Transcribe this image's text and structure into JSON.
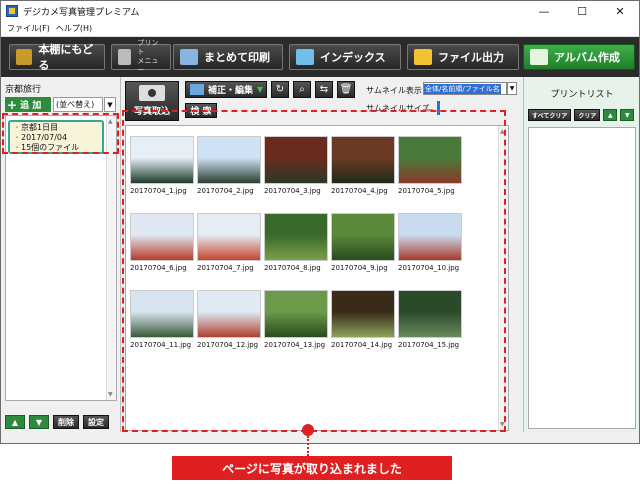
{
  "window": {
    "title": "デジカメ写真管理プレミアム",
    "controls": [
      "—",
      "☐",
      "✕"
    ]
  },
  "menu": [
    "ファイル(F)",
    "ヘルプ(H)"
  ],
  "toolbar": {
    "back_label": "本棚にもどる",
    "print_menu_line1": "プリント",
    "print_menu_line2": "メニュー",
    "batch_print_label": "まとめて印刷",
    "index_label": "インデックス",
    "export_label": "ファイル出力",
    "album_label": "アルバム作成"
  },
  "left_panel": {
    "title": "京都旅行",
    "add_label": "追 加",
    "sort_label": "(並べ替え)",
    "album_item": {
      "name": "京都1日目",
      "date": "2017/07/04",
      "count": "15個のファイル"
    },
    "delete_label": "削除",
    "settings_label": "設定"
  },
  "center": {
    "import_label": "写真取込",
    "edit_label": "補正・編集",
    "search_label": "検 索",
    "thumb_display_label": "サムネイル表示",
    "thumb_display_value": "全体/名前順/ファイル名",
    "thumb_size_label": "サムネイルサイズ"
  },
  "photos": [
    {
      "name": "20170704_1.jpg",
      "colors": [
        "#e6eef6",
        "#1f3a2a"
      ]
    },
    {
      "name": "20170704_2.jpg",
      "colors": [
        "#cfe2f4",
        "#2c3e2e"
      ]
    },
    {
      "name": "20170704_3.jpg",
      "colors": [
        "#6b2a1e",
        "#2a3a24"
      ]
    },
    {
      "name": "20170704_4.jpg",
      "colors": [
        "#6a3a24",
        "#1e2a1a"
      ]
    },
    {
      "name": "20170704_5.jpg",
      "colors": [
        "#4a7a3a",
        "#8a3a2a"
      ]
    },
    {
      "name": "20170704_6.jpg",
      "colors": [
        "#dfe8f2",
        "#b83a2a"
      ]
    },
    {
      "name": "20170704_7.jpg",
      "colors": [
        "#e4ecf4",
        "#c6442e"
      ]
    },
    {
      "name": "20170704_8.jpg",
      "colors": [
        "#3a6a2a",
        "#7aa04a"
      ]
    },
    {
      "name": "20170704_9.jpg",
      "colors": [
        "#5a8a3a",
        "#2a4a1e"
      ]
    },
    {
      "name": "20170704_10.jpg",
      "colors": [
        "#c9dcef",
        "#a83a2a"
      ]
    },
    {
      "name": "20170704_11.jpg",
      "colors": [
        "#d8e4f0",
        "#3a5a3a"
      ]
    },
    {
      "name": "20170704_12.jpg",
      "colors": [
        "#e0eaf4",
        "#b04030"
      ]
    },
    {
      "name": "20170704_13.jpg",
      "colors": [
        "#6a9a4a",
        "#2a4a1e"
      ]
    },
    {
      "name": "20170704_14.jpg",
      "colors": [
        "#3a2a1a",
        "#8aa45a"
      ]
    },
    {
      "name": "20170704_15.jpg",
      "colors": [
        "#2a4a2a",
        "#6a8a5a"
      ]
    }
  ],
  "right_panel": {
    "title": "プリントリスト",
    "clear_all_label": "すべてクリア",
    "clear_label": "クリア"
  },
  "callout": "ページに写真が取り込まれました",
  "accent_color": "#e02020"
}
